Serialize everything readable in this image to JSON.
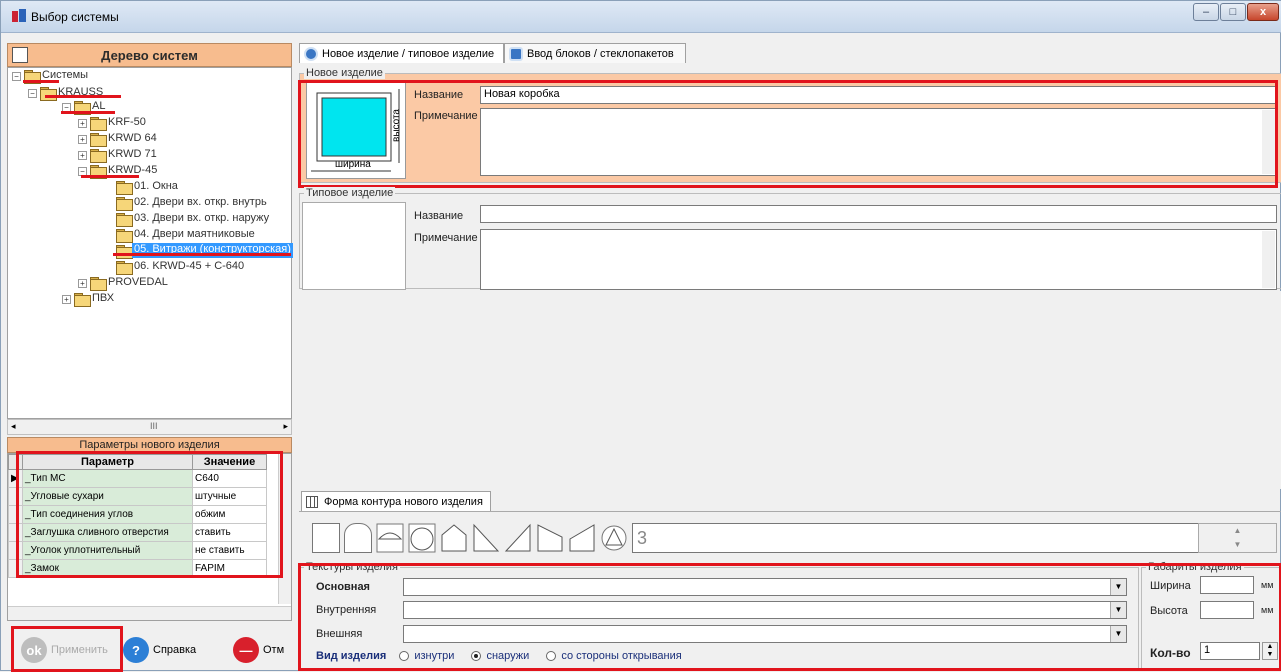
{
  "window": {
    "title": "Выбор системы"
  },
  "tree": {
    "header": "Дерево систем",
    "nodes": {
      "systems": "Системы",
      "krauss": "KRAUSS",
      "al": "AL",
      "krf50": "KRF-50",
      "krwd64": "KRWD 64",
      "krwd71": "KRWD 71",
      "krwd45": "KRWD-45",
      "okna": "01. Окна",
      "doors_in": "02. Двери вх. откр. внутрь",
      "doors_out": "03. Двери вх. откр. наружу",
      "doors_pend": "04. Двери маятниковые",
      "vitrazhi": "05. Витражи (конструкторская)",
      "krwd45c": "06. KRWD-45 + C-640",
      "provedal": "PROVEDAL",
      "pvh": "ПВХ"
    },
    "hscroll": "III"
  },
  "params": {
    "title": "Параметры нового изделия",
    "col_param": "Параметр",
    "col_value": "Значение",
    "rows": [
      {
        "name": "_Тип МС",
        "value": "C640"
      },
      {
        "name": "_Угловые сухари",
        "value": "штучные"
      },
      {
        "name": "_Тип соединения углов",
        "value": "обжим"
      },
      {
        "name": "_Заглушка сливного отверстия",
        "value": "ставить"
      },
      {
        "name": "_Уголок уплотнительный",
        "value": "не ставить"
      },
      {
        "name": "_Замок",
        "value": "FAPIM"
      }
    ]
  },
  "buttons": {
    "apply": "Применить",
    "help": "Справка",
    "cancel": "Отм"
  },
  "tabs": {
    "tab1": "Новое изделие / типовое изделие",
    "tab2": "Ввод блоков / стеклопакетов"
  },
  "new_item": {
    "group": "Новое изделие",
    "name_label": "Название",
    "name_value": "Новая коробка",
    "note_label": "Примечание",
    "width_label": "ширина",
    "height_label": "высота"
  },
  "typical": {
    "group": "Типовое изделие",
    "name_label": "Название",
    "note_label": "Примечание"
  },
  "contour": {
    "tab": "Форма контура нового изделия",
    "count": "3"
  },
  "textures": {
    "group": "Текстуры изделия",
    "main": "Основная",
    "inner": "Внутренняя",
    "outer": "Внешняя",
    "view_label": "Вид изделия",
    "opt_inside": "изнутри",
    "opt_outside": "снаружи",
    "opt_side": "со стороны открывания"
  },
  "dimensions": {
    "group": "Габариты изделия",
    "width": "Ширина",
    "height": "Высота",
    "unit": "мм",
    "qty_label": "Кол-во",
    "qty_value": "1"
  }
}
